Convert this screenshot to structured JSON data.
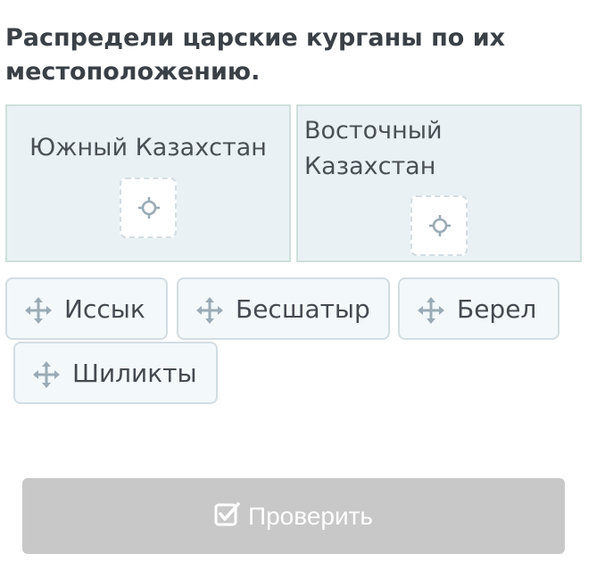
{
  "task": {
    "title": "Распредели царские курганы по их местоположению."
  },
  "zones": [
    {
      "label": "Южный Казахстан"
    },
    {
      "label": "Восточный Казахстан"
    }
  ],
  "draggable_items": [
    {
      "label": "Иссык"
    },
    {
      "label": "Бесшатыр"
    },
    {
      "label": "Берел"
    },
    {
      "label": "Шиликты"
    }
  ],
  "check_button": {
    "label": "Проверить",
    "icon": "checkbox-check-icon",
    "state": "disabled"
  },
  "icons": {
    "drop_slot": "crosshair-icon",
    "chip": "move-arrows-icon"
  },
  "colors": {
    "zone_background": "#e9f1f4",
    "zone_border": "#cfe0da",
    "chip_background": "#f3f8fb",
    "chip_border": "#d2dde3",
    "icon": "#9aabb6",
    "button_disabled": "#c8c8c8",
    "title_text": "#3b4047"
  }
}
